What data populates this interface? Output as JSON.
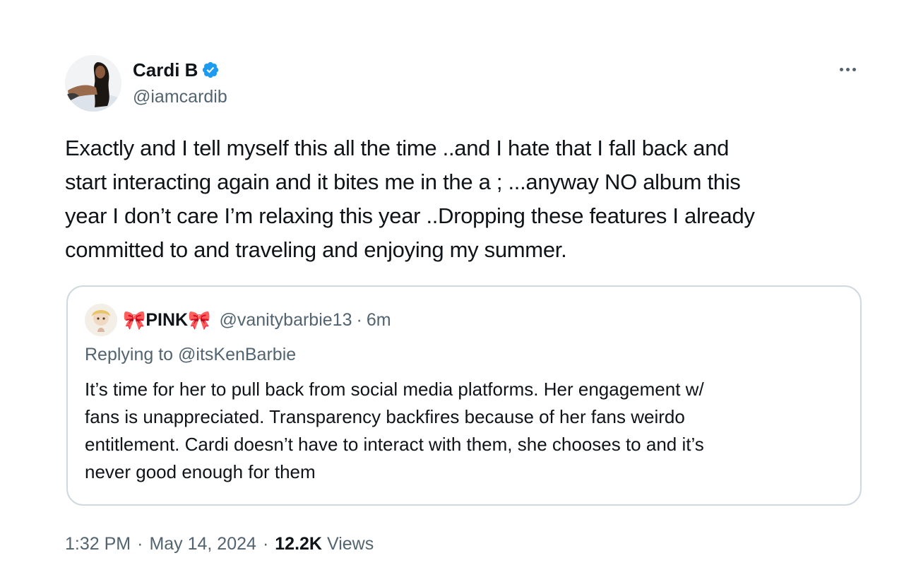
{
  "author": {
    "display_name": "Cardi B",
    "handle": "@iamcardib",
    "verified_icon": "verified-badge-icon",
    "verified_color": "#1d9bf0"
  },
  "more_icon": "more-horizontal-icon",
  "tweet_text": "Exactly and I tell myself this all the time ..and I hate that I fall back and\nstart interacting again and it bites me in the a   ; ...anyway NO album this\nyear I don’t care I’m relaxing this year ..Dropping these features I already\ncommitted to and traveling and enjoying my summer.",
  "quoted": {
    "display_name": "PINK",
    "bow_left": "🎀",
    "bow_right": "🎀",
    "handle": "@vanitybarbie13",
    "separator": "·",
    "time": "6m",
    "replying_to": "Replying to @itsKenBarbie",
    "text": "It’s time for her to pull back from social media platforms. Her engagement w/\nfans is unappreciated. Transparency backfires because of her fans weirdo\nentitlement. Cardi doesn’t have to interact with them, she chooses to and it’s\nnever good enough for them"
  },
  "footer": {
    "time": "1:32 PM",
    "separator": "·",
    "date": "May 14, 2024",
    "views_count": "12.2K",
    "views_label": "Views"
  },
  "colors": {
    "text_primary": "#0f1419",
    "text_secondary": "#536471",
    "border": "#cfd9de",
    "bow": "#c8102e"
  }
}
